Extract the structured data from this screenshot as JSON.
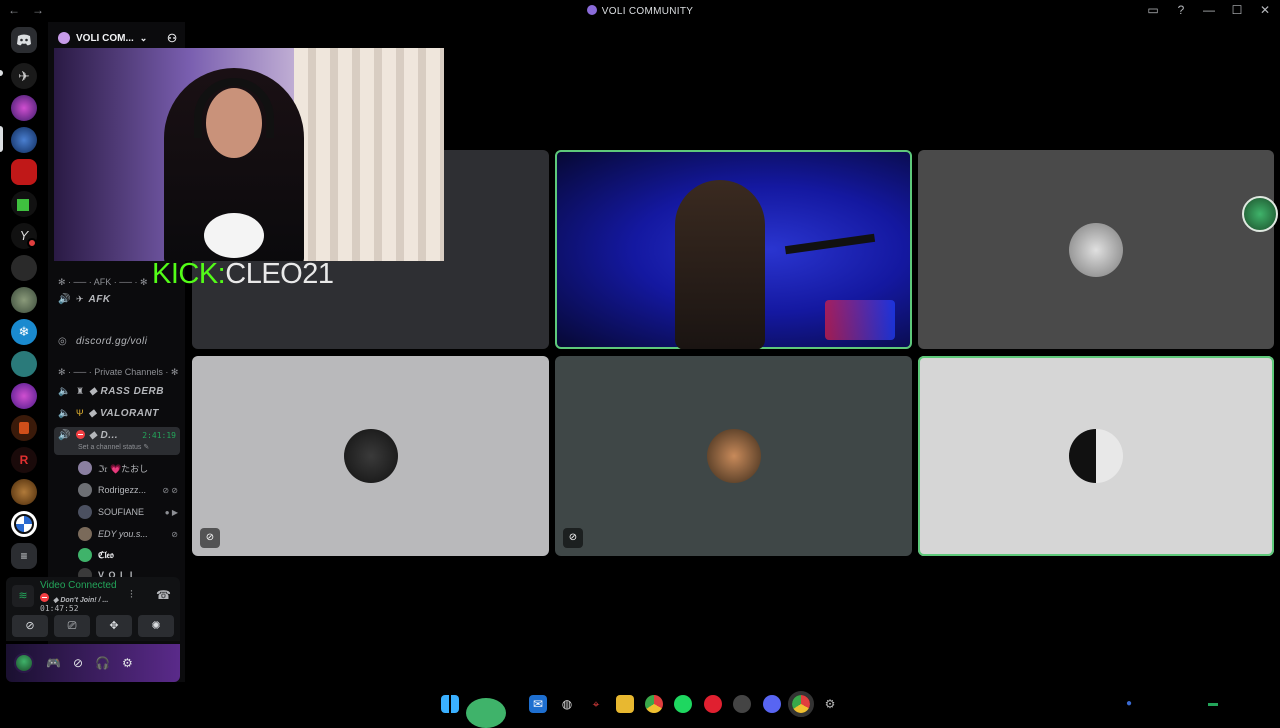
{
  "window": {
    "title": "VOLI COMMUNITY",
    "nav_back": "←",
    "nav_forward": "→",
    "controls": {
      "inbox": "▭",
      "help": "?",
      "minimize": "—",
      "maximize": "☐",
      "close": "✕"
    }
  },
  "server": {
    "name": "VOLI COM...",
    "chevron": "⌄",
    "invite_icon": "person-add-icon"
  },
  "channels": {
    "afk_category": "✻ · ── · AFK · ── · ✻",
    "afk_channel": "AFK",
    "invite_channel": "discord.gg/voli",
    "private_category": "✻ · ── · Private Channels · ✻",
    "rass_derb": "◆ RASS DERB",
    "valorant": "◆ VALORANT",
    "active_channel": "◆ D...",
    "active_timer": "2:41:19",
    "status_placeholder": "Set a channel status ✎"
  },
  "members": [
    {
      "name": "ℑ𝔯 💗たおし",
      "color": "#8a7fa0"
    },
    {
      "name": "Rodrigezz...",
      "color": "#6d6f74"
    },
    {
      "name": "SOUFIANE",
      "color": "#4b5060"
    },
    {
      "name": "EDY you.s...",
      "color": "#7a6a5a"
    },
    {
      "name": "ℭ𝔩𝔢𝔬",
      "color": "#3fb36a"
    },
    {
      "name": "V O L I",
      "color": "#3a3a3a"
    }
  ],
  "voice_panel": {
    "status": "Video Connected",
    "channel": "◆ Don't Join! / ...",
    "time": "01:47:52"
  },
  "overlay": {
    "kick_prefix": "KICK:",
    "kick_name": "CLEO21"
  },
  "colors": {
    "accent_green": "#23a55a",
    "kick_green": "#53fc18",
    "speaking_border": "#5ec97a"
  },
  "taskbar_icons": [
    "windows-icon",
    "widgets-icon",
    "outlook-icon",
    "steam-icon",
    "maps-icon",
    "folder-icon",
    "chrome-icon",
    "spotify-icon",
    "app-icon",
    "game-icon",
    "discord-icon",
    "chrome-active-icon",
    "settings-icon"
  ]
}
